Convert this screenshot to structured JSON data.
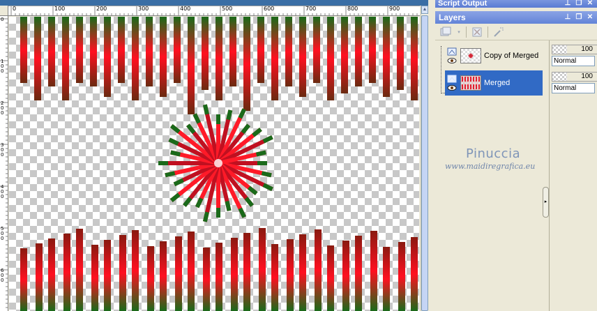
{
  "panels": {
    "script_output": {
      "title": "Script Output"
    },
    "layers": {
      "title": "Layers",
      "items": [
        {
          "name": "Copy of Merged",
          "opacity": "100",
          "blend_mode": "Normal",
          "selected": false
        },
        {
          "name": "Merged",
          "opacity": "100",
          "blend_mode": "Normal",
          "selected": true
        }
      ]
    }
  },
  "ruler": {
    "horizontal_labels": [
      "0",
      "100",
      "200",
      "300",
      "400",
      "500",
      "600",
      "700",
      "800",
      "900"
    ],
    "vertical_labels": [
      "0",
      "1 0 0",
      "2 0 0",
      "3 0 0",
      "4 0 0",
      "5 0 0",
      "6 0 0"
    ]
  },
  "watermark": {
    "name": "Pinuccia",
    "url": "www.maidiregrafica.eu"
  },
  "colors": {
    "stripe_red": "#ff1020",
    "stripe_green": "#1a6a1a",
    "selection": "#316ac5",
    "title_bar": "#6384d8"
  }
}
